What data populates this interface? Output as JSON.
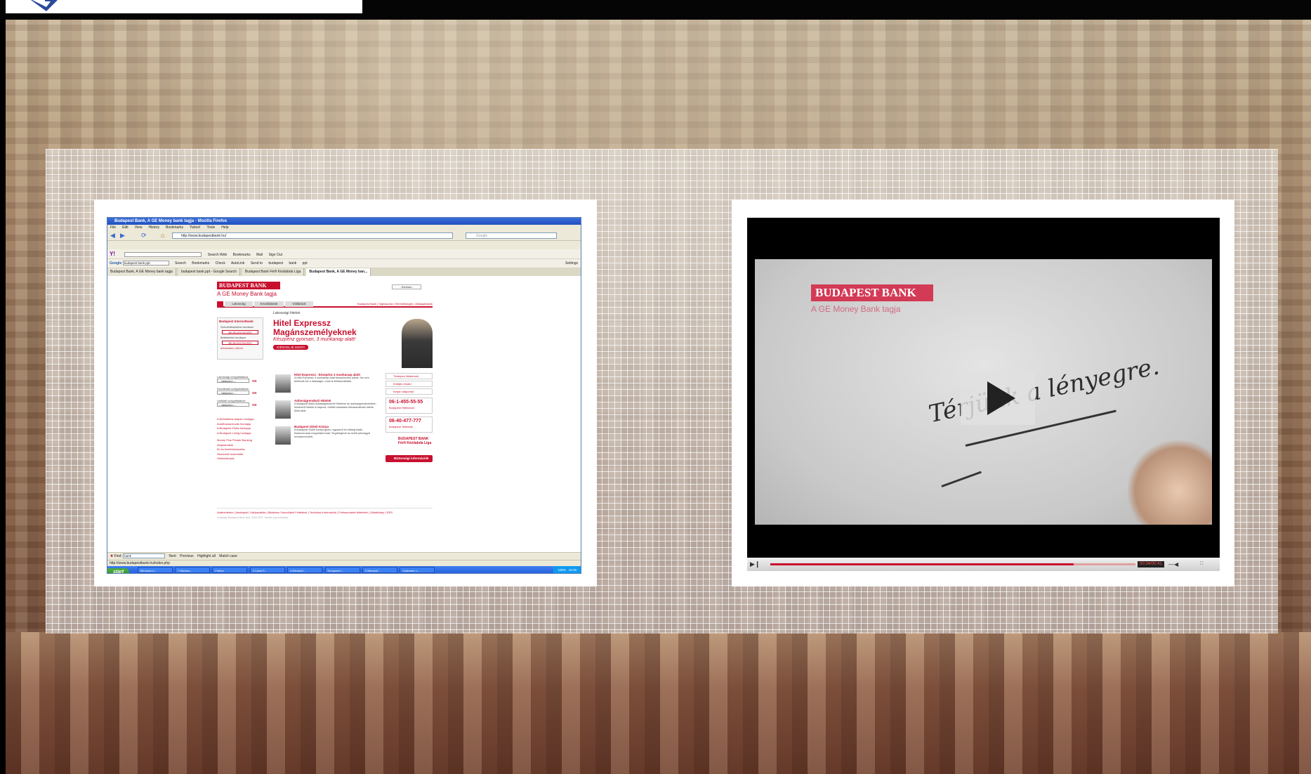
{
  "browser": {
    "title": "Budapest Bank, A GE Money bank tagja - Mozilla Firefox",
    "menu": [
      "File",
      "Edit",
      "View",
      "History",
      "Bookmarks",
      "Yahoo!",
      "Tools",
      "Help"
    ],
    "url": "http://www.budapestbank.hu/",
    "search_placeholder": "Google",
    "yahoo_toolbar": [
      "Search Web",
      "Bookmarks",
      "Mail",
      "Sign Out"
    ],
    "google_toolbar": {
      "query": "budapest bank.ppt",
      "items": [
        "Search",
        "Bookmarks",
        "Check",
        "AutoLink",
        "Send to",
        "budapest",
        "bank",
        "ppt",
        "Settings"
      ]
    },
    "tabs": [
      "Budapest Bank, A GE Money bank tagja",
      "budapest bank.ppt - Google Search",
      "Budapest Bank Férfi Kézilabda Liga",
      "Budapest Bank, A GE Money ban..."
    ],
    "find": {
      "label": "Find:",
      "value": "bank",
      "next": "Next",
      "previous": "Previous",
      "highlight": "Highlight all",
      "match": "Match case"
    },
    "status": "http://www.budapestbank.hu/index.php",
    "taskbar": {
      "start": "start",
      "tasks": [
        "Windows Li...",
        "7 Microso...",
        "Firefox",
        "2 Lotus S...",
        "4 Microsof...",
        "European I...",
        "2 Microsof...",
        "Customer c..."
      ],
      "tray": "100%",
      "clock": "15:49"
    }
  },
  "site": {
    "logo": "BUDAPEST BANK",
    "tagline": "A GE Money Bank tagja",
    "lang": "- Keresés -",
    "nav": [
      "Lakosság",
      "Kisvállalatok",
      "Vállalatok"
    ],
    "toplinks": "Budapest Bank | Sajtószoba | Elérhetőségek | Állásajánlatok",
    "crumb": "Lakossági hitelek",
    "netbank": {
      "title": "Budapest Internetbank",
      "line1": "Szerződésesítési rendszer",
      "btn": "BEJELENTKEZÉS",
      "line2": "Betekintési rendszer",
      "btn2": "BEJELENTKEZÉS",
      "links": "Információ | demó"
    },
    "hero": {
      "h1a": "Hitel Expressz",
      "h1b": "Magánszemélyeknek",
      "sub": "Készpénz gyorsan, 3 munkanap alatt!",
      "btn": "IGÉNYELJE MOST!"
    },
    "selects": [
      {
        "label": "Lakossági szolgáltatások",
        "value": "-- választon --",
        "ok": "OK"
      },
      {
        "label": "Kisvállalati szolgáltatások",
        "value": "-- választon --",
        "ok": "OK"
      },
      {
        "label": "Vállalati szolgáltatások",
        "value": "-- választon --",
        "ok": "OK"
      }
    ],
    "leftlinks": [
      "A Befektetési alapok honlapja",
      "Autófinanszírozás honlapja",
      "A Budapest Flotta honlapja",
      "A Budapest Lízing honlapja",
      "Money Plus Private Banking",
      "Alapkamatok",
      "BJ és fizetésbiztosítás",
      "Összesítő ismertetők",
      "Hirdetmények"
    ],
    "news": [
      {
        "title": "Hitel Expressz - készpénz 3 munkanap alatt!",
        "desc": "A Hitel Expressz 3 munkanap alatt készpénzhez juthat. Ha nem telefonál ezt a hatóságot, most is felhasználható."
      },
      {
        "title": "Adósságrendező Hitelek",
        "desc": "A Budapest Bank Adósságrendező Hitelével az adósságrendezésben résztvevő hitelek is kapunk, mellett szabadon felhasználható hitelre. Most akár."
      },
      {
        "title": "Budapest Üzleti Kártya",
        "desc": "A Budapest Üzleti Kártya gyors, egyszerű és kötség kiadó finanszírozási megoldást kínál. Segítségével az üzleti pénzügyei rendszerezhető."
      }
    ],
    "right": [
      "Térképes fiókkereső",
      "Küldjön email-t",
      "Kérjen időpontot"
    ],
    "phones": [
      {
        "num": "06-1-455-55-55",
        "lbl": "Budapest Hitelvonal"
      },
      {
        "num": "06-40-477-777",
        "lbl": "Budapest Telebank"
      }
    ],
    "liga": "BUDAPEST BANK Férfi Kézilabda Liga",
    "security": "Biztonsági információk",
    "footer": "Adatvédelem | Adatlapok | Kártyaváltás | Általános Szerződési Feltételek | Technikai információk | Felhasználási feltételek | Oldaltérkép | RSS",
    "copyright": "Copyright Budapest Bank Nyrt. 2000-2007. Minden jog fenntartva."
  },
  "video": {
    "logo": "BUDAPEST BANK",
    "tagline": "A GE Money Bank tagja",
    "handwriting": "Térjünk a lényegre.",
    "time": "00:34/00:41",
    "progress": 0.83
  }
}
